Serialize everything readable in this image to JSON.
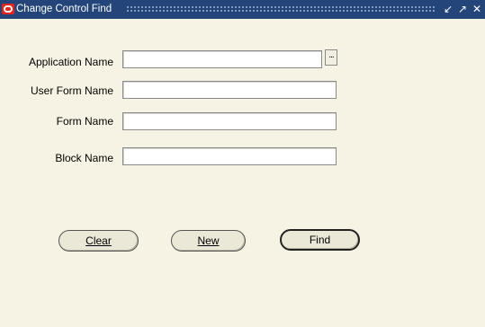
{
  "window": {
    "title": "Change Control Find",
    "controls": {
      "minimize": "↙",
      "maximize": "↗",
      "close": "✕"
    }
  },
  "form": {
    "application_name": {
      "label": "Application Name",
      "value": ""
    },
    "user_form_name": {
      "label": "User Form Name",
      "value": ""
    },
    "form_name": {
      "label": "Form Name",
      "value": ""
    },
    "block_name": {
      "label": "Block Name",
      "value": ""
    },
    "lov_button": "..."
  },
  "buttons": {
    "clear": "Clear",
    "new": "New",
    "find": "Find"
  }
}
